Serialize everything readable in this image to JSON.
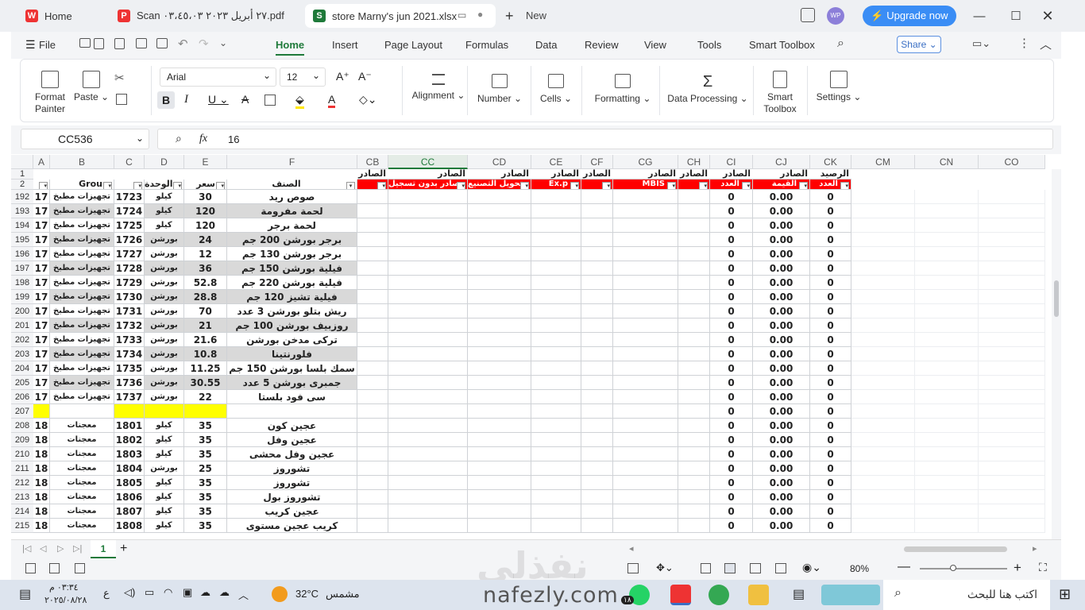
{
  "tabs": [
    {
      "label": "Home",
      "icon": "wps-logo-icon"
    },
    {
      "label": "Scan ٢٧ أبريل ٢٠٢٣ ٠٣،٤٥،٠٣.pdf",
      "icon": "pdf-icon"
    },
    {
      "label": "store Marny's jun 2021.xlsx",
      "icon": "spreadsheet-icon"
    }
  ],
  "new_tab": "New",
  "user_initials": "WP",
  "upgrade": "Upgrade now",
  "menu": {
    "file": "File",
    "items": [
      "Home",
      "Insert",
      "Page Layout",
      "Formulas",
      "Data",
      "Review",
      "View",
      "Tools",
      "Smart Toolbox"
    ],
    "share": "Share"
  },
  "ribbon": {
    "format_painter": "Format Painter",
    "paste": "Paste",
    "font": "Arial",
    "font_size": "12",
    "alignment": "Alignment",
    "number": "Number",
    "cells": "Cells",
    "formatting": "Formatting",
    "data_processing": "Data Processing",
    "smart_toolbox": "Smart Toolbox",
    "settings": "Settings"
  },
  "formula": {
    "name_box": "CC536",
    "fx": "fx",
    "value": "16"
  },
  "columns": {
    "left": [
      "A",
      "B",
      "C",
      "D",
      "E",
      "F"
    ],
    "right": [
      "CB",
      "CC",
      "CD",
      "CE",
      "CF",
      "CG",
      "CH",
      "CI",
      "CJ",
      "CK",
      "CM",
      "CN",
      "CO"
    ]
  },
  "row1_right": [
    "الصادر",
    "الصادر",
    "الصادر",
    "الصادر",
    "الصادر",
    "الصادر",
    "الصادر",
    "الصادر",
    "الصادر",
    "الرصيد"
  ],
  "row2": {
    "B": "Grou",
    "D": "الوحدة",
    "E": "سعر",
    "F": "الصنف",
    "CC": "صادر بدون تسجيل",
    "CD": "تحويل التصنيع",
    "CE": "Ex.p",
    "CG": "MBIS",
    "CI": "العدد",
    "CJ": "القيمة",
    "CK": "العدد"
  },
  "rows": [
    {
      "n": "192",
      "a": "17",
      "b": "تجهيزات مطبخ",
      "c": "1723",
      "d": "كيلو",
      "e": "30",
      "f": "صوص ريد",
      "ci": "0",
      "cj": "0.00",
      "ck": "0",
      "g": false
    },
    {
      "n": "193",
      "a": "17",
      "b": "تجهيزات مطبخ",
      "c": "1724",
      "d": "كيلو",
      "e": "120",
      "f": "لحمة مفرومة",
      "ci": "0",
      "cj": "0.00",
      "ck": "0",
      "g": true
    },
    {
      "n": "194",
      "a": "17",
      "b": "تجهيزات مطبخ",
      "c": "1725",
      "d": "كيلو",
      "e": "120",
      "f": "لحمة برجر",
      "ci": "0",
      "cj": "0.00",
      "ck": "0",
      "g": false
    },
    {
      "n": "195",
      "a": "17",
      "b": "تجهيزات مطبخ",
      "c": "1726",
      "d": "بورشن",
      "e": "24",
      "f": "برجر بورشن 200 جم",
      "ci": "0",
      "cj": "0.00",
      "ck": "0",
      "g": true
    },
    {
      "n": "196",
      "a": "17",
      "b": "تجهيزات مطبخ",
      "c": "1727",
      "d": "بورشن",
      "e": "12",
      "f": "برجر بورشن 130 جم",
      "ci": "0",
      "cj": "0.00",
      "ck": "0",
      "g": false
    },
    {
      "n": "197",
      "a": "17",
      "b": "تجهيزات مطبخ",
      "c": "1728",
      "d": "بورشن",
      "e": "36",
      "f": "فيلية بورشن 150 جم",
      "ci": "0",
      "cj": "0.00",
      "ck": "0",
      "g": true
    },
    {
      "n": "198",
      "a": "17",
      "b": "تجهيزات مطبخ",
      "c": "1729",
      "d": "بورشن",
      "e": "52.8",
      "f": "فيلية بورشن 220 جم",
      "ci": "0",
      "cj": "0.00",
      "ck": "0",
      "g": false
    },
    {
      "n": "199",
      "a": "17",
      "b": "تجهيزات مطبخ",
      "c": "1730",
      "d": "بورشن",
      "e": "28.8",
      "f": "فيلية تشيز 120 جم",
      "ci": "0",
      "cj": "0.00",
      "ck": "0",
      "g": true
    },
    {
      "n": "200",
      "a": "17",
      "b": "تجهيزات مطبخ",
      "c": "1731",
      "d": "بورشن",
      "e": "70",
      "f": "ريش بتلو بورشن 3 عدد",
      "ci": "0",
      "cj": "0.00",
      "ck": "0",
      "g": false
    },
    {
      "n": "201",
      "a": "17",
      "b": "تجهيزات مطبخ",
      "c": "1732",
      "d": "بورشن",
      "e": "21",
      "f": "روزبيف بورشن 100 جم",
      "ci": "0",
      "cj": "0.00",
      "ck": "0",
      "g": true
    },
    {
      "n": "202",
      "a": "17",
      "b": "تجهيزات مطبخ",
      "c": "1733",
      "d": "بورشن",
      "e": "21.6",
      "f": "تركى مدخن بورشن",
      "ci": "0",
      "cj": "0.00",
      "ck": "0",
      "g": false
    },
    {
      "n": "203",
      "a": "17",
      "b": "تجهيزات مطبخ",
      "c": "1734",
      "d": "بورشن",
      "e": "10.8",
      "f": "فلورنتينا",
      "ci": "0",
      "cj": "0.00",
      "ck": "0",
      "g": true
    },
    {
      "n": "204",
      "a": "17",
      "b": "تجهيزات مطبخ",
      "c": "1735",
      "d": "بورشن",
      "e": "11.25",
      "f": "سمك بلسا بورشن 150 جم",
      "ci": "0",
      "cj": "0.00",
      "ck": "0",
      "g": false
    },
    {
      "n": "205",
      "a": "17",
      "b": "تجهيزات مطبخ",
      "c": "1736",
      "d": "بورشن",
      "e": "30.55",
      "f": "جمبرى بورشن 5 عدد",
      "ci": "0",
      "cj": "0.00",
      "ck": "0",
      "g": true
    },
    {
      "n": "206",
      "a": "17",
      "b": "تجهيزات مطبخ",
      "c": "1737",
      "d": "بورشن",
      "e": "22",
      "f": "سى فود بلستا",
      "ci": "0",
      "cj": "0.00",
      "ck": "0",
      "g": false
    },
    {
      "n": "207",
      "a": "",
      "b": "",
      "c": "",
      "d": "",
      "e": "",
      "f": "",
      "ci": "0",
      "cj": "0.00",
      "ck": "0",
      "y": true
    },
    {
      "n": "208",
      "a": "18",
      "b": "معجنات",
      "c": "1801",
      "d": "كيلو",
      "e": "35",
      "f": "عجين كون",
      "ci": "0",
      "cj": "0.00",
      "ck": "0",
      "g": false
    },
    {
      "n": "209",
      "a": "18",
      "b": "معجنات",
      "c": "1802",
      "d": "كيلو",
      "e": "35",
      "f": "عجين وفل",
      "ci": "0",
      "cj": "0.00",
      "ck": "0",
      "g": false
    },
    {
      "n": "210",
      "a": "18",
      "b": "معجنات",
      "c": "1803",
      "d": "كيلو",
      "e": "35",
      "f": "عجين وفل محشى",
      "ci": "0",
      "cj": "0.00",
      "ck": "0",
      "g": false
    },
    {
      "n": "211",
      "a": "18",
      "b": "معجنات",
      "c": "1804",
      "d": "بورشن",
      "e": "25",
      "f": "تشوروز",
      "ci": "0",
      "cj": "0.00",
      "ck": "0",
      "g": false
    },
    {
      "n": "212",
      "a": "18",
      "b": "معجنات",
      "c": "1805",
      "d": "كيلو",
      "e": "35",
      "f": "تشوروز",
      "ci": "0",
      "cj": "0.00",
      "ck": "0",
      "g": false
    },
    {
      "n": "213",
      "a": "18",
      "b": "معجنات",
      "c": "1806",
      "d": "كيلو",
      "e": "35",
      "f": "تشوروز بول",
      "ci": "0",
      "cj": "0.00",
      "ck": "0",
      "g": false
    },
    {
      "n": "214",
      "a": "18",
      "b": "معجنات",
      "c": "1807",
      "d": "كيلو",
      "e": "35",
      "f": "عجين كريب",
      "ci": "0",
      "cj": "0.00",
      "ck": "0",
      "g": false
    },
    {
      "n": "215",
      "a": "18",
      "b": "معجنات",
      "c": "1808",
      "d": "كيلو",
      "e": "35",
      "f": "كريب عجين مستوى",
      "ci": "0",
      "cj": "0.00",
      "ck": "0",
      "g": false
    }
  ],
  "sheet_tab": "1",
  "status": {
    "zoom": "80%"
  },
  "watermark": {
    "arabic": "نفذلي",
    "latin": "nafezly.com"
  },
  "taskbar": {
    "search": "اكتب هنا للبحث",
    "weather": "32°C",
    "weather_text": "مشمس",
    "time": "٠٣:٣٤ م",
    "date": "٢٠٢٥/٠٨/٢٨",
    "lang": "ع",
    "badge": "١٨"
  },
  "colors": {
    "accent": "#1f7a3a",
    "upgrade": "#3a8df5",
    "red": "#ff0000",
    "gray": "#d9d9d9",
    "yellow": "#ffff00"
  }
}
